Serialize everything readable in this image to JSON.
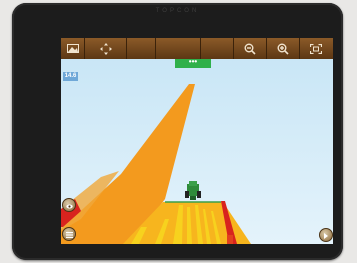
{
  "device": {
    "brand": "TOPCON"
  },
  "toolbar": {
    "buttons": [
      {
        "name": "map-view-button",
        "icon": "image-icon"
      },
      {
        "name": "pan-button",
        "icon": "move-arrows-icon"
      },
      {
        "name": "zoom-out-button",
        "icon": "zoom-out-icon"
      },
      {
        "name": "zoom-in-button",
        "icon": "zoom-in-icon"
      },
      {
        "name": "fit-extents-button",
        "icon": "fit-screen-icon"
      }
    ]
  },
  "status": {
    "speed_label": "14.6"
  },
  "more_tab": {
    "label": "•••"
  },
  "side_buttons": [
    {
      "name": "camera-view-button",
      "icon": "eye-icon"
    },
    {
      "name": "layers-button",
      "icon": "list-icon"
    },
    {
      "name": "settings-button",
      "icon": "arrow-icon"
    }
  ],
  "colors": {
    "sky": "#d2ecf8",
    "coverage_orange": "#f39a1e",
    "coverage_yellow": "#f7d21e",
    "overlap_red": "#d8231e",
    "tractor_green": "#2e8b3a",
    "toolbar_brown": "#6e4520"
  }
}
